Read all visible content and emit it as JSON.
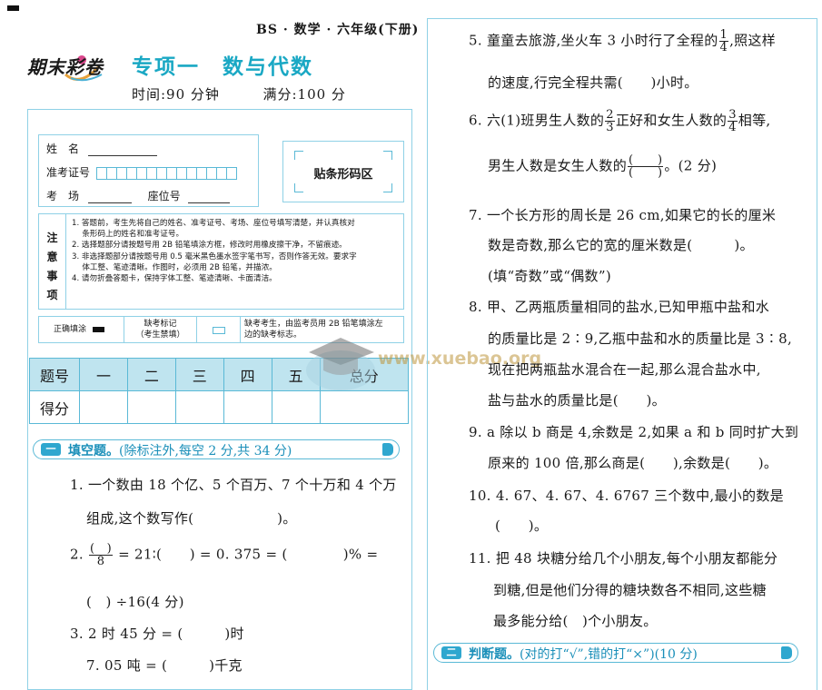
{
  "header": {
    "right": "BS · 数学 · 六年级(下册)",
    "logo_text": "期末彩卷",
    "title": "专项一　数与代数",
    "time_label": "时间:90 分钟",
    "score_label": "满分:100 分"
  },
  "info": {
    "name_label": "姓　名",
    "ticket_label": "准考证号",
    "venue_label": "考　场",
    "seat_label": "座位号",
    "barcode_label": "贴条形码区"
  },
  "notes": {
    "head": [
      "注",
      "意",
      "事",
      "项"
    ],
    "items": [
      "1. 答题前，考生先将自己的姓名、准考证号、考场、座位号填写清楚，并认真核对",
      "　 条形码上的姓名和准考证号。",
      "2. 选择题部分请按题号用 2B 铅笔填涂方框，修改时用橡皮擦干净，不留痕迹。",
      "3. 非选择题部分请按题号用 0.5 毫米黑色墨水签字笔书写，否则作答无效。要求字",
      "　 体工整、笔迹清晰。作图时，必须用 2B 铅笔，并描浓。",
      "4. 请勿折叠答题卡，保持字体工整、笔迹清晰、卡面清洁。"
    ]
  },
  "fill_example": {
    "correct_label": "正确填涂",
    "absent_label_1": "缺考标记",
    "absent_label_2": "（考生禁填）",
    "absent_note_1": "缺考考生，由监考员用 2B 铅笔填涂左",
    "absent_note_2": "边的缺考标志。"
  },
  "score_table": {
    "header": [
      "题号",
      "一",
      "二",
      "三",
      "四",
      "五",
      "总分"
    ],
    "row_label": "得分"
  },
  "section1": {
    "num": "一",
    "title": "填空题。",
    "note": "(除标注外,每空 2 分,共 34 分)"
  },
  "section2": {
    "num": "二",
    "title": "判断题。",
    "note": "(对的打“√”,错的打“×”)(10 分)"
  },
  "left_questions": {
    "q1a": "1. 一个数由 18 个亿、5 个百万、7 个十万和 4 个万",
    "q1b": "组成,这个数写作(　　　　　　)。",
    "q2_pre": "2.",
    "q2_num": "(　)",
    "q2_den": "8",
    "q2_rest": "= 21∶(　　) = 0. 375 = (　　　　)% =",
    "q2b": "(　) ÷16(4 分)",
    "q3a": "3. 2 时 45 分 = (　　　)时",
    "q3b": "7. 05 吨 = (　　　)千克"
  },
  "right_questions": {
    "q5a_pre": "5. 童童去旅游,坐火车 3 小时行了全程的",
    "q5a_num": "1",
    "q5a_den": "4",
    "q5a_post": ",照这样",
    "q5b": "的速度,行完全程共需(　　)小时。",
    "q6a_pre": "6. 六(1)班男生人数的",
    "q6a_n1": "2",
    "q6a_d1": "3",
    "q6a_mid": "正好和女生人数的",
    "q6a_n2": "3",
    "q6a_d2": "4",
    "q6a_post": "相等,",
    "q6b_pre": "男生人数是女生人数的",
    "q6b_num": "(　　)",
    "q6b_den": "(　　)",
    "q6b_post": "。(2 分)",
    "q7a": "7. 一个长方形的周长是 26 cm,如果它的长的厘米",
    "q7b": "数是奇数,那么它的宽的厘米数是(　　　)。",
    "q7c": "(填“奇数”或“偶数”)",
    "q8a": "8. 甲、乙两瓶质量相同的盐水,已知甲瓶中盐和水",
    "q8b": "的质量比是 2∶9,乙瓶中盐和水的质量比是 3∶8,",
    "q8c": "现在把两瓶盐水混合在一起,那么混合盐水中,",
    "q8d": "盐与盐水的质量比是(　　)。",
    "q9a": "9. a 除以 b 商是 4,余数是 2,如果 a 和 b 同时扩大到",
    "q9b": "原来的 100 倍,那么商是(　　),余数是(　　)。",
    "q10a": "10. 4. 67、4. 67、4. 6767 三个数中,最小的数是",
    "q10b": "(　　)。",
    "q11a": "11. 把 48 块糖分给几个小朋友,每个小朋友都能分",
    "q11b": "到糖,但是他们分得的糖块数各不相同,这些糖",
    "q11c": "最多能分给(　)个小朋友。"
  },
  "watermark": "www.xuebao.org"
}
